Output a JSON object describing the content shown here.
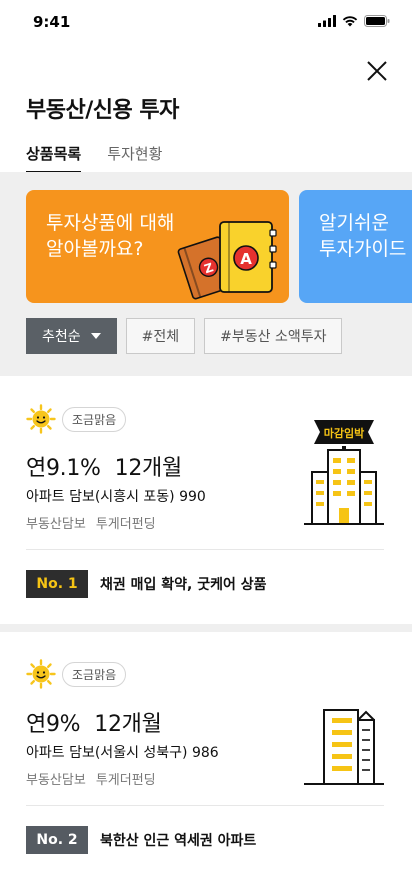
{
  "status": {
    "time": "9:41"
  },
  "header": {
    "title": "부동산/신용 투자"
  },
  "tabs": [
    {
      "label": "상품목록",
      "active": true
    },
    {
      "label": "투자현황",
      "active": false
    }
  ],
  "banners": [
    {
      "line1": "투자상품에 대해",
      "line2": "알아볼까요?",
      "color": "#f6941d"
    },
    {
      "line1": "알기쉬운",
      "line2": "투자가이드",
      "color": "#57a6f6"
    }
  ],
  "filters": {
    "sort_label": "추천순",
    "chips": [
      "#전체",
      "#부동산 소액투자"
    ]
  },
  "products": [
    {
      "weather": "조금맑음",
      "rate": "연9.1%",
      "term": "12개월",
      "description": "아파트 담보(시흥시 포동) 990",
      "tags": [
        "부동산담보",
        "투게더펀딩"
      ],
      "deadline_badge": "마감임박",
      "rank": "No. 1",
      "headline": "채권 매입 확약, 굿케어 상품"
    },
    {
      "weather": "조금맑음",
      "rate": "연9%",
      "term": "12개월",
      "description": "아파트 담보(서울시 성북구) 986",
      "tags": [
        "부동산담보",
        "투게더펀딩"
      ],
      "rank": "No. 2",
      "headline": "북한산 인근 역세권 아파트"
    }
  ],
  "colors": {
    "accent_orange": "#f6941d",
    "accent_blue": "#57a6f6",
    "rank_yellow": "#f6c415",
    "dark": "#2d2d2d"
  },
  "icons": [
    "signal-icon",
    "wifi-icon",
    "battery-icon",
    "close-icon",
    "sun-icon",
    "building-icon",
    "chevron-down-icon"
  ]
}
